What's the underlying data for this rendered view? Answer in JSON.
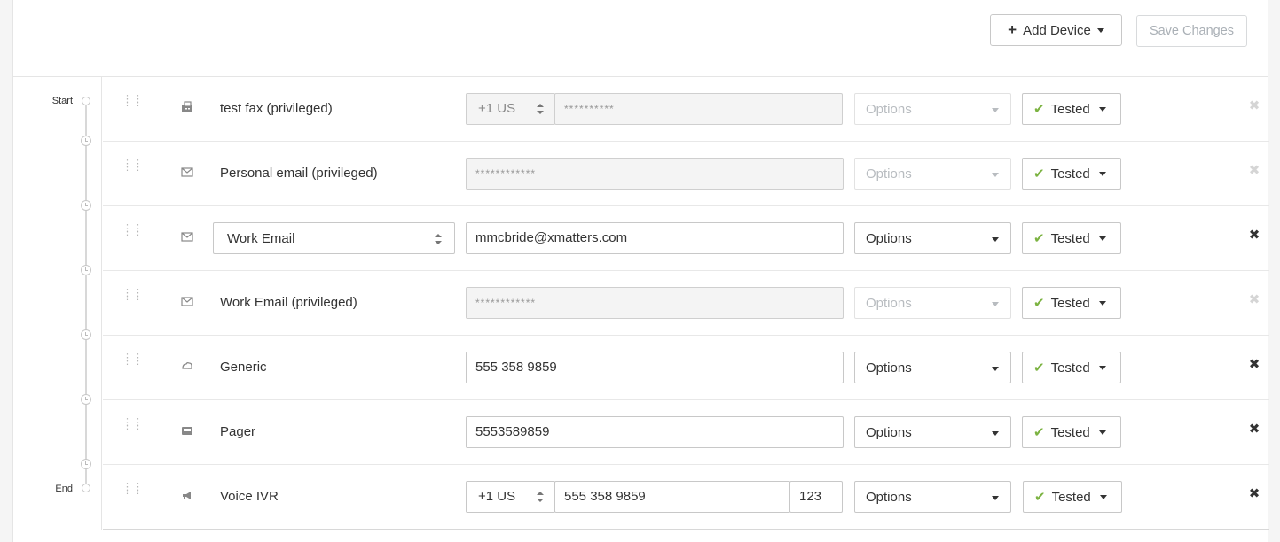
{
  "toolbar": {
    "add_device_label": "Add Device",
    "save_changes_label": "Save Changes"
  },
  "timeline": {
    "start_label": "Start",
    "end_label": "End"
  },
  "devices": [
    {
      "name": "test fax (privileged)",
      "icon": "fax-icon",
      "country_code": "+1 US",
      "value": "**********",
      "options": "Options",
      "status": "Tested",
      "editable": false
    },
    {
      "name": "Personal email (privileged)",
      "icon": "envelope-icon",
      "value": "************",
      "options": "Options",
      "status": "Tested",
      "editable": false
    },
    {
      "name": "Work Email",
      "icon": "envelope-icon",
      "value": "mmcbride@xmatters.com",
      "options": "Options",
      "status": "Tested",
      "editable": true
    },
    {
      "name": "Work Email (privileged)",
      "icon": "envelope-icon",
      "value": "************",
      "options": "Options",
      "status": "Tested",
      "editable": false
    },
    {
      "name": "Generic",
      "icon": "generic-device-icon",
      "value": "555 358 9859",
      "options": "Options",
      "status": "Tested",
      "editable": true
    },
    {
      "name": "Pager",
      "icon": "pager-icon",
      "value": "5553589859",
      "options": "Options",
      "status": "Tested",
      "editable": true
    },
    {
      "name": "Voice IVR",
      "icon": "megaphone-icon",
      "country_code": "+1 US",
      "value": "555 358 9859",
      "extension": "123",
      "options": "Options",
      "status": "Tested",
      "editable": true
    }
  ],
  "colors": {
    "check_green": "#7cb342",
    "disabled_text": "#b8bcc0",
    "border": "#c8c8c8"
  }
}
